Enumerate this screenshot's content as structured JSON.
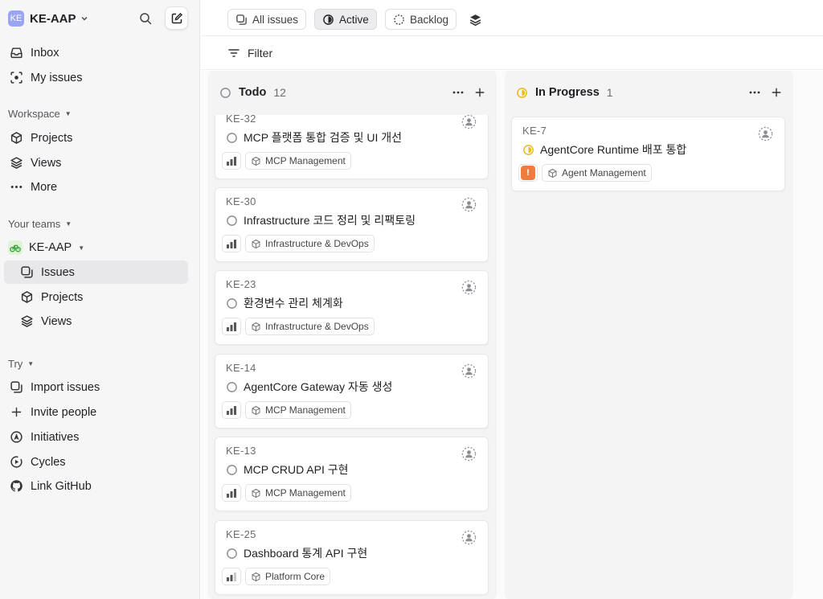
{
  "workspace": {
    "badge": "KE",
    "name": "KE-AAP"
  },
  "sidebar": {
    "top_items": [
      {
        "label": "Inbox",
        "icon": "inbox-icon"
      },
      {
        "label": "My issues",
        "icon": "my-issues-icon"
      }
    ],
    "workspace_label": "Workspace",
    "workspace_items": [
      {
        "label": "Projects",
        "icon": "cube-icon"
      },
      {
        "label": "Views",
        "icon": "layers-icon"
      },
      {
        "label": "More",
        "icon": "more-icon"
      }
    ],
    "teams_label": "Your teams",
    "team": {
      "name": "KE-AAP",
      "icon": "bicycle-icon"
    },
    "team_items": [
      {
        "label": "Issues",
        "icon": "issues-icon",
        "active": true
      },
      {
        "label": "Projects",
        "icon": "cube-icon"
      },
      {
        "label": "Views",
        "icon": "layers-icon"
      }
    ],
    "try_label": "Try",
    "try_items": [
      {
        "label": "Import issues",
        "icon": "import-icon"
      },
      {
        "label": "Invite people",
        "icon": "plus-icon"
      },
      {
        "label": "Initiatives",
        "icon": "initiatives-icon"
      },
      {
        "label": "Cycles",
        "icon": "cycles-icon"
      },
      {
        "label": "Link GitHub",
        "icon": "github-icon"
      }
    ]
  },
  "view_tabs": [
    {
      "label": "All issues",
      "active": false
    },
    {
      "label": "Active",
      "active": true
    },
    {
      "label": "Backlog",
      "active": false
    }
  ],
  "filter": {
    "label": "Filter"
  },
  "columns": [
    {
      "title": "Todo",
      "count": "12",
      "status": "todo",
      "cards": [
        {
          "id": "KE-32",
          "title": "MCP 플랫폼 통합 검증 및 UI 개선",
          "project": "MCP Management",
          "priority": "medium"
        },
        {
          "id": "KE-30",
          "title": "Infrastructure 코드 정리 및 리팩토링",
          "project": "Infrastructure & DevOps",
          "priority": "medium"
        },
        {
          "id": "KE-23",
          "title": "환경변수 관리 체계화",
          "project": "Infrastructure & DevOps",
          "priority": "medium"
        },
        {
          "id": "KE-14",
          "title": "AgentCore Gateway 자동 생성",
          "project": "MCP Management",
          "priority": "medium"
        },
        {
          "id": "KE-13",
          "title": "MCP CRUD API 구현",
          "project": "MCP Management",
          "priority": "medium"
        },
        {
          "id": "KE-25",
          "title": "Dashboard 통계 API 구현",
          "project": "Platform Core",
          "priority": "low"
        }
      ]
    },
    {
      "title": "In Progress",
      "count": "1",
      "status": "in-progress",
      "cards": [
        {
          "id": "KE-7",
          "title": "AgentCore Runtime 배포 통합",
          "project": "Agent Management",
          "priority": "urgent"
        }
      ]
    }
  ],
  "colors": {
    "accent_yellow": "#e9b824",
    "urgent": "#f07b3f",
    "badge": "#9aa5f2"
  }
}
